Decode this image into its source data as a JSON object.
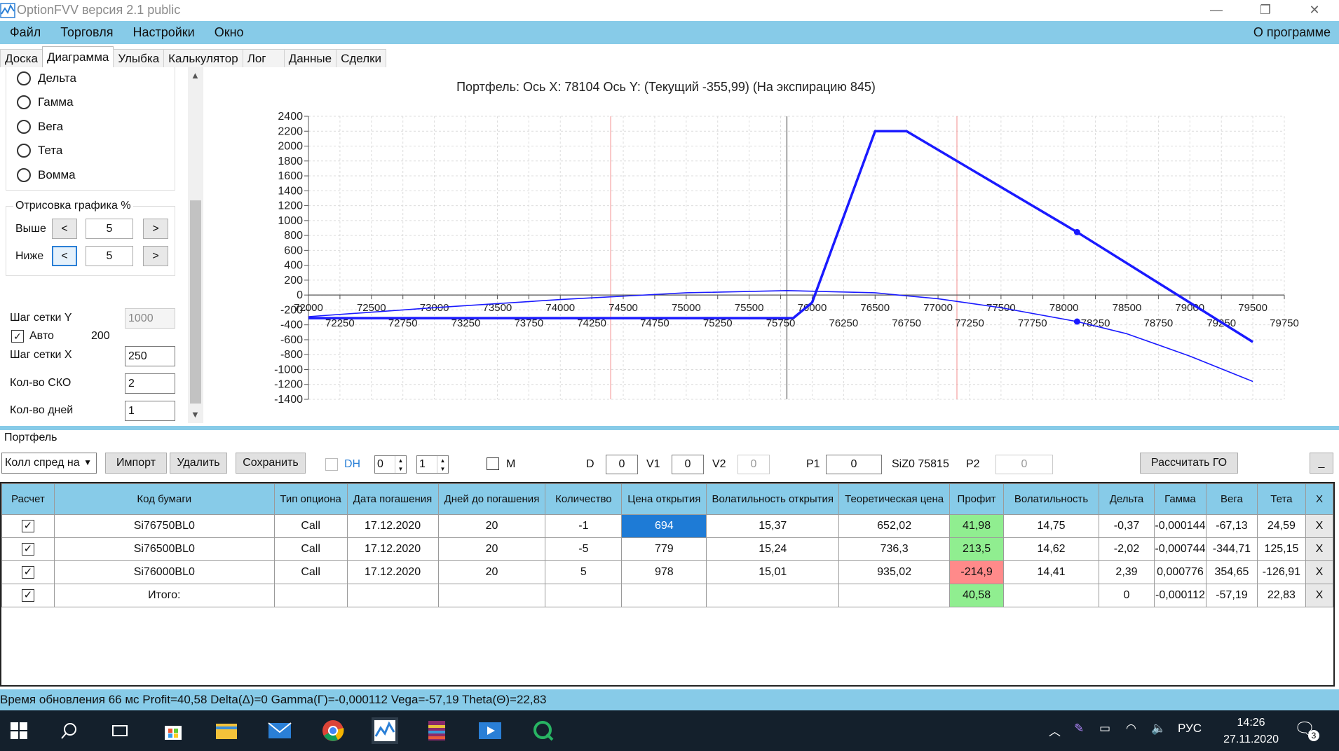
{
  "window": {
    "title": "OptionFVV версия 2.1 public",
    "min_icon": "minimize-icon",
    "restore_icon": "restore-icon",
    "close_icon": "close-icon"
  },
  "menu": {
    "items": [
      "Файл",
      "Торговля",
      "Настройки",
      "Окно"
    ],
    "about": "О программе"
  },
  "tabs": [
    "Доска",
    "Диаграмма",
    "Улыбка",
    "Калькулятор",
    "Лог",
    "Данные",
    "Сделки"
  ],
  "active_tab": "Диаграмма",
  "left": {
    "radios": [
      "Дельта",
      "Гамма",
      "Вега",
      "Тета",
      "Вомма"
    ],
    "draw_group": {
      "legend": "Отрисовка графика %",
      "above_label": "Выше",
      "above_value": "5",
      "below_label": "Ниже",
      "below_value": "5",
      "dec": "<",
      "inc": ">"
    },
    "grid_y_label": "Шаг сетки Y",
    "grid_y_value": "1000",
    "auto_label": "Авто",
    "auto_value": "200",
    "grid_x_label": "Шаг сетки X",
    "grid_x_value": "250",
    "sko_label": "Кол-во СКО",
    "sko_value": "2",
    "days_label": "Кол-во дней",
    "days_value": "1"
  },
  "chart_title": "Портфель:  Ось X:  78104  Ось Y:   (Текущий  -355,99)   (На экспирацию  845)",
  "chart_data": {
    "type": "line",
    "title": "Портфель:  Ось X:  78104  Ось Y:   (Текущий  -355,99)   (На экспирацию  845)",
    "xlim": [
      72000,
      79750
    ],
    "ylim": [
      -1400,
      2400
    ],
    "y_ticks": [
      2400,
      2200,
      2000,
      1800,
      1600,
      1400,
      1200,
      1000,
      800,
      600,
      400,
      200,
      0,
      -200,
      -400,
      -600,
      -800,
      -1000,
      -1200,
      -1400
    ],
    "x_ticks_upper": [
      72000,
      72500,
      73000,
      73500,
      74000,
      74500,
      75000,
      75500,
      76000,
      76500,
      77000,
      77500,
      78000,
      78500,
      79000,
      79500
    ],
    "x_ticks_lower": [
      72250,
      72750,
      73250,
      73750,
      74250,
      74750,
      75250,
      75750,
      76250,
      76750,
      77250,
      77750,
      78250,
      78750,
      79250,
      79750
    ],
    "vertical_lines": {
      "red": [
        74400,
        77150
      ],
      "gray": [
        75800
      ]
    },
    "grid": true,
    "series": [
      {
        "role": "expiration",
        "x": [
          72000,
          75750,
          75850,
          76000,
          76500,
          76750,
          78104,
          79500
        ],
        "y": [
          -310,
          -310,
          -310,
          -100,
          2200,
          2200,
          845,
          -630
        ]
      },
      {
        "role": "current",
        "x": [
          72000,
          73000,
          74000,
          75000,
          75800,
          76500,
          77000,
          77500,
          78104,
          78500,
          79000,
          79500
        ],
        "y": [
          -290,
          -170,
          -60,
          30,
          60,
          30,
          -50,
          -170,
          -355.99,
          -520,
          -820,
          -1160
        ]
      }
    ],
    "markers": [
      {
        "x": 78104,
        "y": 845
      },
      {
        "x": 78104,
        "y": -355.99
      }
    ]
  },
  "portfolio": {
    "label": "Портфель",
    "combo_value": "Колл спред на",
    "import": "Импорт",
    "delete": "Удалить",
    "save": "Сохранить",
    "dh_label": "DH",
    "spin1": "0",
    "spin2": "1",
    "m_label": "M",
    "d_label": "D",
    "d_value": "0",
    "v1_label": "V1",
    "v1_value": "0",
    "v2_label": "V2",
    "v2_value": "0",
    "p1_label": "P1",
    "p1_value": "0",
    "siz_label": "SiZ0 75815",
    "p2_label": "P2",
    "p2_value": "0",
    "calc_go": "Рассчитать ГО",
    "minimize": "_"
  },
  "table": {
    "headers": [
      "Расчет",
      "Код бумаги",
      "Тип опциона",
      "Дата погашения",
      "Дней до погашения",
      "Количество",
      "Цена открытия",
      "Волатильность открытия",
      "Теоретическая цена",
      "Профит",
      "Волатильность",
      "Дельта",
      "Гамма",
      "Вега",
      "Тета",
      "X"
    ],
    "rows": [
      {
        "check": "✓",
        "code": "Si76750BL0",
        "type": "Call",
        "date": "17.12.2020",
        "days": "20",
        "qty": "-1",
        "price": "694",
        "vol_open": "15,37",
        "theo": "652,02",
        "profit": "41,98",
        "vol": "14,75",
        "delta": "-0,37",
        "gamma": "-0,000144",
        "vega": "-67,13",
        "theta": "24,59",
        "x": "X"
      },
      {
        "check": "✓",
        "code": "Si76500BL0",
        "type": "Call",
        "date": "17.12.2020",
        "days": "20",
        "qty": "-5",
        "price": "779",
        "vol_open": "15,24",
        "theo": "736,3",
        "profit": "213,5",
        "vol": "14,62",
        "delta": "-2,02",
        "gamma": "-0,000744",
        "vega": "-344,71",
        "theta": "125,15",
        "x": "X"
      },
      {
        "check": "✓",
        "code": "Si76000BL0",
        "type": "Call",
        "date": "17.12.2020",
        "days": "20",
        "qty": "5",
        "price": "978",
        "vol_open": "15,01",
        "theo": "935,02",
        "profit": "-214,9",
        "vol": "14,41",
        "delta": "2,39",
        "gamma": "0,000776",
        "vega": "354,65",
        "theta": "-126,91",
        "x": "X"
      }
    ],
    "total": {
      "check": "✓",
      "code": "Итого:",
      "profit": "40,58",
      "delta": "0",
      "gamma": "-0,000112",
      "vega": "-57,19",
      "theta": "22,83",
      "x": "X"
    }
  },
  "status": "Время обновления 66 мс  Profit=40,58 Delta(Δ)=0 Gamma(Γ)=-0,000112 Vega=-57,19 Theta(Θ)=22,83",
  "taskbar": {
    "lang": "РУС",
    "time": "14:26",
    "date": "27.11.2020",
    "notif_count": "3"
  },
  "colors": {
    "accent": "#87cbe8",
    "selected_cell": "#1e7bd6",
    "profit_pos": "#90ee90",
    "profit_neg": "#ff8a8a",
    "chart_line": "#1a1aff"
  }
}
